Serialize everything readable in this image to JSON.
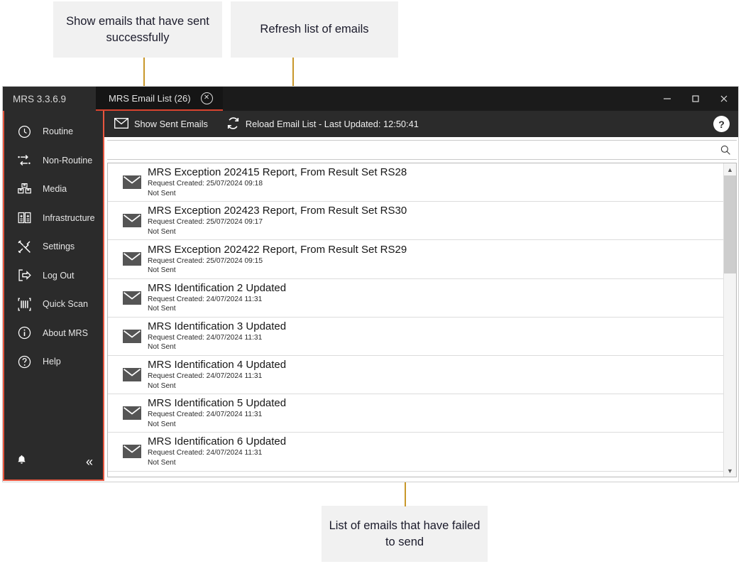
{
  "annotations": [
    {
      "id": "a1",
      "text": "Show emails that have sent successfully"
    },
    {
      "id": "a2",
      "text": "Refresh list of emails"
    },
    {
      "id": "a3",
      "text": "List of emails that have failed to send"
    }
  ],
  "window": {
    "app_version": "MRS 3.3.6.9",
    "tab": {
      "label": "MRS Email List (26)",
      "close_icon": "close-circle-icon"
    },
    "controls": {
      "minimize": "minimize-icon",
      "maximize": "maximize-icon",
      "close": "close-icon"
    },
    "accent_color": "#e8563f",
    "tab_underline_color": "#d9432f"
  },
  "sidebar": {
    "items": [
      {
        "label": "Routine",
        "icon": "clock-icon"
      },
      {
        "label": "Non-Routine",
        "icon": "shuffle-arrows-icon"
      },
      {
        "label": "Media",
        "icon": "media-boxes-icon"
      },
      {
        "label": "Infrastructure",
        "icon": "infrastructure-icon"
      },
      {
        "label": "Settings",
        "icon": "tools-icon"
      },
      {
        "label": "Log Out",
        "icon": "logout-icon"
      },
      {
        "label": "Quick Scan",
        "icon": "barcode-scan-icon"
      },
      {
        "label": "About MRS",
        "icon": "info-circle-icon"
      },
      {
        "label": "Help",
        "icon": "question-circle-icon"
      }
    ],
    "footer": {
      "notifications_icon": "bell-icon",
      "collapse_icon": "chevron-double-left-icon",
      "collapse_glyph": "«"
    }
  },
  "toolbar": {
    "show_sent_label": "Show Sent Emails",
    "show_sent_icon": "envelope-icon",
    "reload_label": "Reload Email List - Last Updated: 12:50:41",
    "reload_icon": "refresh-icon",
    "help_label": "?"
  },
  "search": {
    "value": "",
    "placeholder": "",
    "icon": "search-icon"
  },
  "email_list": {
    "rows": [
      {
        "subject": "MRS Exception 202415 Report, From Result Set RS28",
        "created": "Request Created: 25/07/2024 09:18",
        "status": "Not Sent"
      },
      {
        "subject": "MRS Exception 202423 Report, From Result Set RS30",
        "created": "Request Created: 25/07/2024 09:17",
        "status": "Not Sent"
      },
      {
        "subject": "MRS Exception 202422 Report, From Result Set RS29",
        "created": "Request Created: 25/07/2024 09:15",
        "status": "Not Sent"
      },
      {
        "subject": "MRS Identification 2 Updated",
        "created": "Request Created: 24/07/2024 11:31",
        "status": "Not Sent"
      },
      {
        "subject": "MRS Identification 3 Updated",
        "created": "Request Created: 24/07/2024 11:31",
        "status": "Not Sent"
      },
      {
        "subject": "MRS Identification 4 Updated",
        "created": "Request Created: 24/07/2024 11:31",
        "status": "Not Sent"
      },
      {
        "subject": "MRS Identification 5 Updated",
        "created": "Request Created: 24/07/2024 11:31",
        "status": "Not Sent"
      },
      {
        "subject": "MRS Identification 6 Updated",
        "created": "Request Created: 24/07/2024 11:31",
        "status": "Not Sent"
      }
    ],
    "row_icon": "envelope-icon",
    "scrollbar": {
      "up_icon": "chevron-up-icon",
      "down_icon": "chevron-down-icon"
    }
  }
}
